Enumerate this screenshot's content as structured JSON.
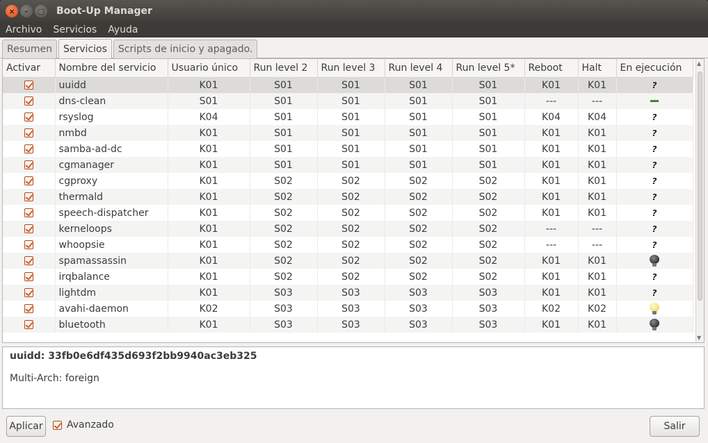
{
  "window": {
    "title": "Boot-Up Manager",
    "close_glyph": "×",
    "min_glyph": "–",
    "max_glyph": "▢"
  },
  "menubar": {
    "items": [
      "Archivo",
      "Servicios",
      "Ayuda"
    ]
  },
  "tabs": [
    {
      "label": "Resumen",
      "active": false
    },
    {
      "label": "Servicios",
      "active": true
    },
    {
      "label": "Scripts de inicio y apagado.",
      "active": false
    }
  ],
  "table": {
    "headers": [
      "Activar",
      "Nombre del servicio",
      "Usuario único",
      "Run level 2",
      "Run level 3",
      "Run level 4",
      "Run level 5*",
      "Reboot",
      "Halt",
      "En ejecución"
    ],
    "rows": [
      {
        "name": "uuidd",
        "single": "K01",
        "rl2": "S01",
        "rl3": "S01",
        "rl4": "S01",
        "rl5": "S01",
        "reboot": "K01",
        "halt": "K01",
        "status": "unknown",
        "selected": true
      },
      {
        "name": "dns-clean",
        "single": "S01",
        "rl2": "S01",
        "rl3": "S01",
        "rl4": "S01",
        "rl5": "S01",
        "reboot": "---",
        "halt": "---",
        "status": "bar"
      },
      {
        "name": "rsyslog",
        "single": "K04",
        "rl2": "S01",
        "rl3": "S01",
        "rl4": "S01",
        "rl5": "S01",
        "reboot": "K04",
        "halt": "K04",
        "status": "unknown"
      },
      {
        "name": "nmbd",
        "single": "K01",
        "rl2": "S01",
        "rl3": "S01",
        "rl4": "S01",
        "rl5": "S01",
        "reboot": "K01",
        "halt": "K01",
        "status": "unknown"
      },
      {
        "name": "samba-ad-dc",
        "single": "K01",
        "rl2": "S01",
        "rl3": "S01",
        "rl4": "S01",
        "rl5": "S01",
        "reboot": "K01",
        "halt": "K01",
        "status": "unknown"
      },
      {
        "name": "cgmanager",
        "single": "K01",
        "rl2": "S01",
        "rl3": "S01",
        "rl4": "S01",
        "rl5": "S01",
        "reboot": "K01",
        "halt": "K01",
        "status": "unknown"
      },
      {
        "name": "cgproxy",
        "single": "K01",
        "rl2": "S02",
        "rl3": "S02",
        "rl4": "S02",
        "rl5": "S02",
        "reboot": "K01",
        "halt": "K01",
        "status": "unknown"
      },
      {
        "name": "thermald",
        "single": "K01",
        "rl2": "S02",
        "rl3": "S02",
        "rl4": "S02",
        "rl5": "S02",
        "reboot": "K01",
        "halt": "K01",
        "status": "unknown"
      },
      {
        "name": "speech-dispatcher",
        "single": "K01",
        "rl2": "S02",
        "rl3": "S02",
        "rl4": "S02",
        "rl5": "S02",
        "reboot": "K01",
        "halt": "K01",
        "status": "unknown"
      },
      {
        "name": "kerneloops",
        "single": "K01",
        "rl2": "S02",
        "rl3": "S02",
        "rl4": "S02",
        "rl5": "S02",
        "reboot": "---",
        "halt": "---",
        "status": "unknown"
      },
      {
        "name": "whoopsie",
        "single": "K01",
        "rl2": "S02",
        "rl3": "S02",
        "rl4": "S02",
        "rl5": "S02",
        "reboot": "---",
        "halt": "---",
        "status": "unknown"
      },
      {
        "name": "spamassassin",
        "single": "K01",
        "rl2": "S02",
        "rl3": "S02",
        "rl4": "S02",
        "rl5": "S02",
        "reboot": "K01",
        "halt": "K01",
        "status": "off"
      },
      {
        "name": "irqbalance",
        "single": "K01",
        "rl2": "S02",
        "rl3": "S02",
        "rl4": "S02",
        "rl5": "S02",
        "reboot": "K01",
        "halt": "K01",
        "status": "unknown"
      },
      {
        "name": "lightdm",
        "single": "K01",
        "rl2": "S03",
        "rl3": "S03",
        "rl4": "S03",
        "rl5": "S03",
        "reboot": "K01",
        "halt": "K01",
        "status": "unknown"
      },
      {
        "name": "avahi-daemon",
        "single": "K02",
        "rl2": "S03",
        "rl3": "S03",
        "rl4": "S03",
        "rl5": "S03",
        "reboot": "K02",
        "halt": "K02",
        "status": "on"
      },
      {
        "name": "bluetooth",
        "single": "K01",
        "rl2": "S03",
        "rl3": "S03",
        "rl4": "S03",
        "rl5": "S03",
        "reboot": "K01",
        "halt": "K01",
        "status": "off"
      }
    ],
    "unknown_glyph": "?"
  },
  "description": {
    "line1": "uuidd:  33fb0e6df435d693f2bb9940ac3eb325",
    "line2": "Multi-Arch: foreign"
  },
  "footer": {
    "apply_label": "Aplicar",
    "advanced_label": "Avanzado",
    "advanced_checked": true,
    "quit_label": "Salir"
  }
}
